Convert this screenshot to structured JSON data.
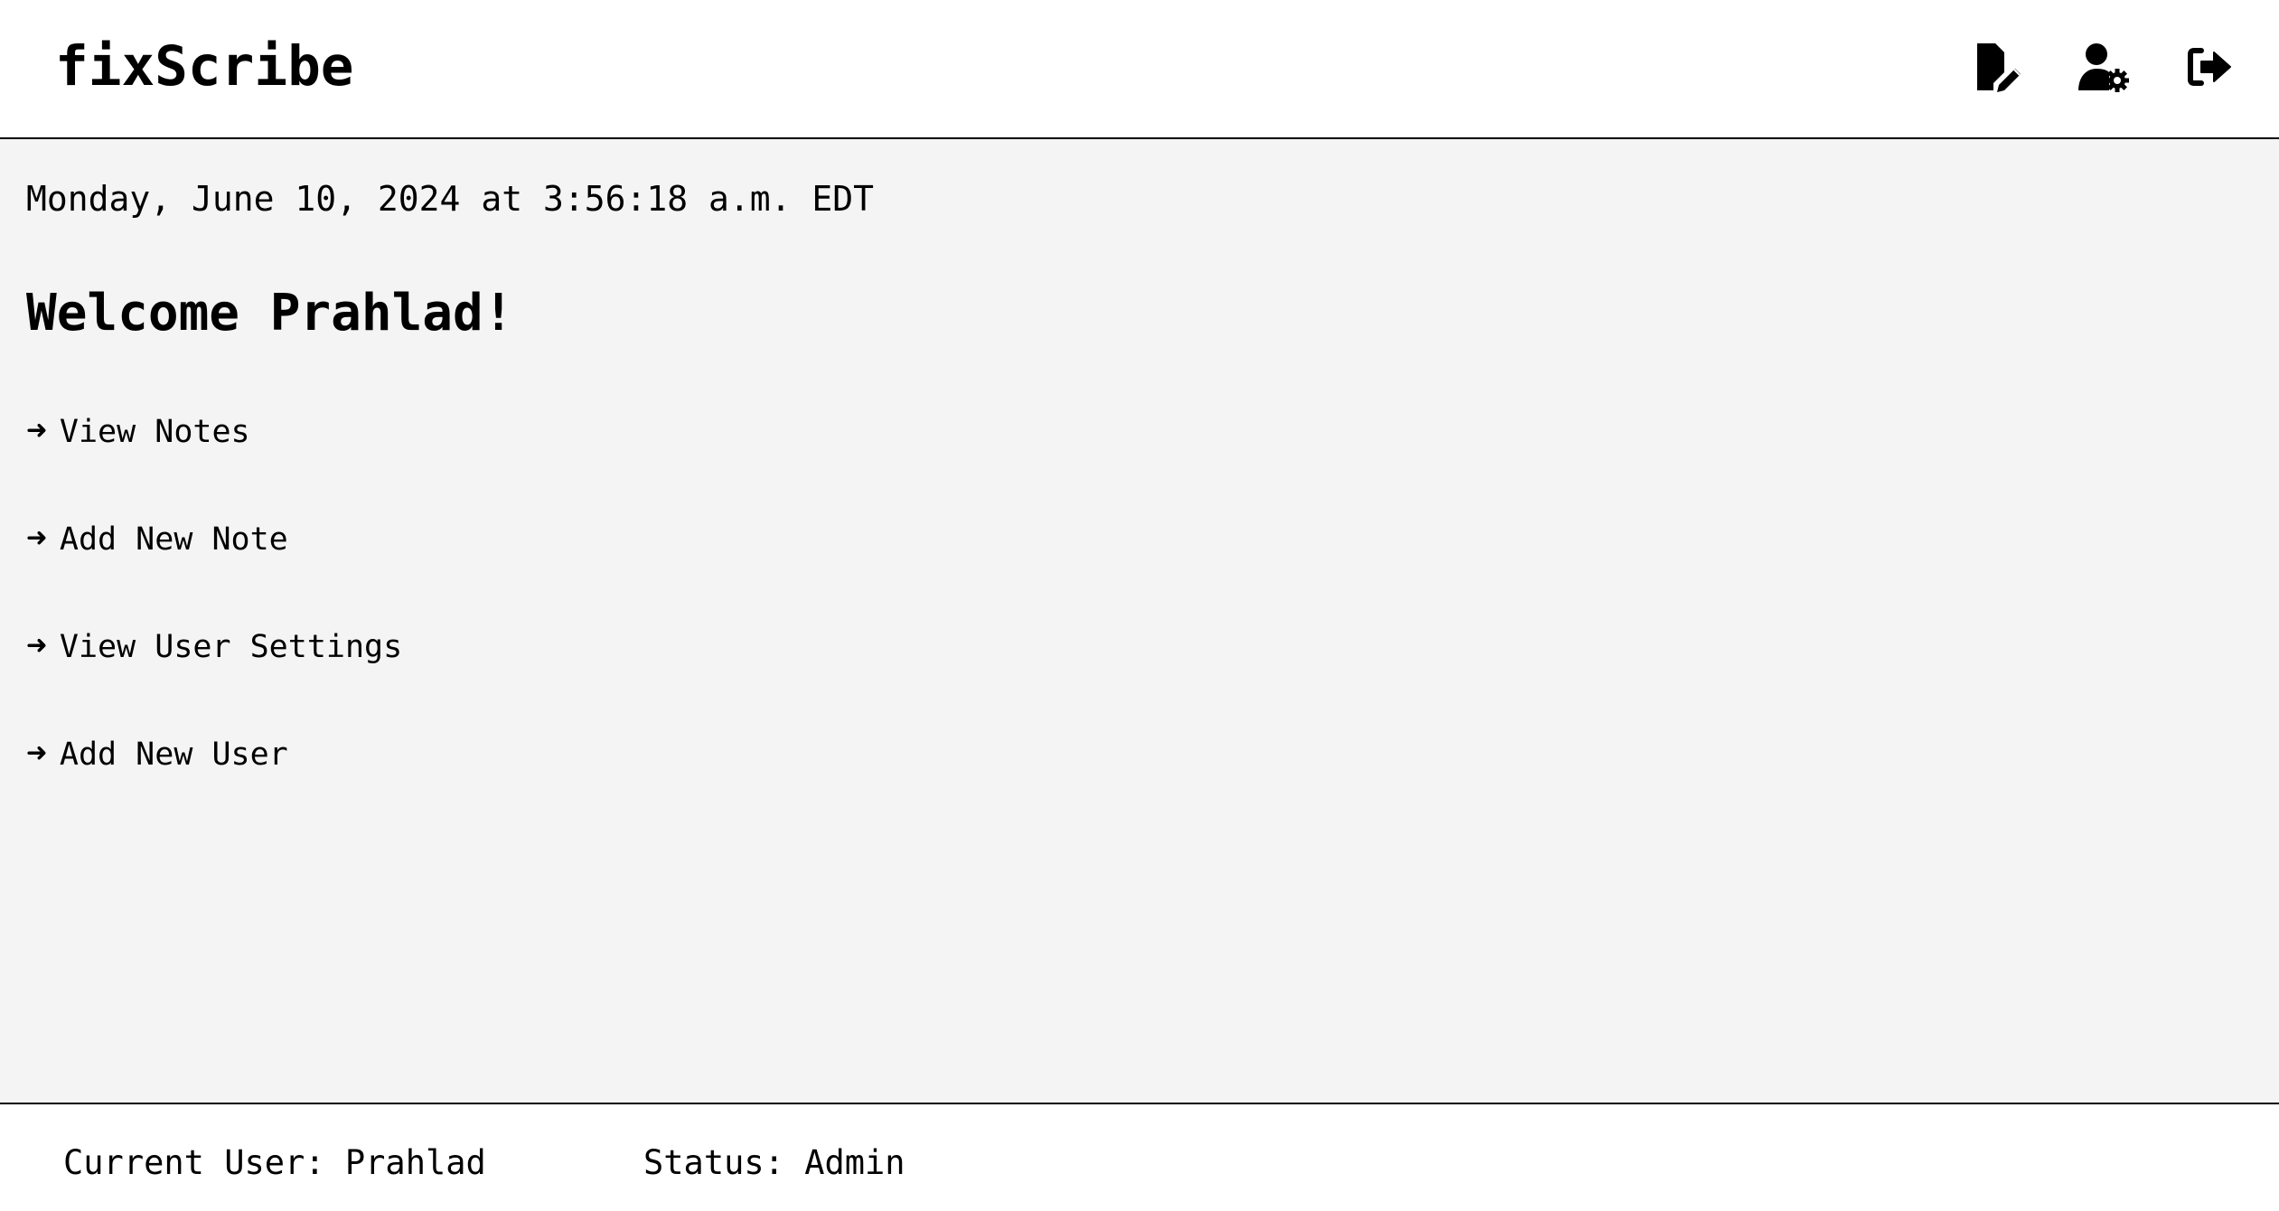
{
  "header": {
    "brand": "fixScribe",
    "icons": [
      {
        "name": "notes-icon",
        "title": "View Notes"
      },
      {
        "name": "user-settings-icon",
        "title": "View User Settings"
      },
      {
        "name": "logout-icon",
        "title": "Logout"
      }
    ]
  },
  "main": {
    "datetime": "Monday, June 10, 2024 at 3:56:18 a.m. EDT",
    "welcome": "Welcome Prahlad!",
    "links": [
      {
        "arrow": "➜",
        "label": "View Notes"
      },
      {
        "arrow": "➜",
        "label": "Add New Note"
      },
      {
        "arrow": "➜",
        "label": "View User Settings"
      },
      {
        "arrow": "➜",
        "label": "Add New User"
      }
    ]
  },
  "footer": {
    "current_user": "Current User: Prahlad",
    "status": "Status: Admin"
  },
  "colors": {
    "background_main": "#f4f4f4",
    "background_header": "#ffffff",
    "text": "#000000",
    "border": "#000000"
  }
}
